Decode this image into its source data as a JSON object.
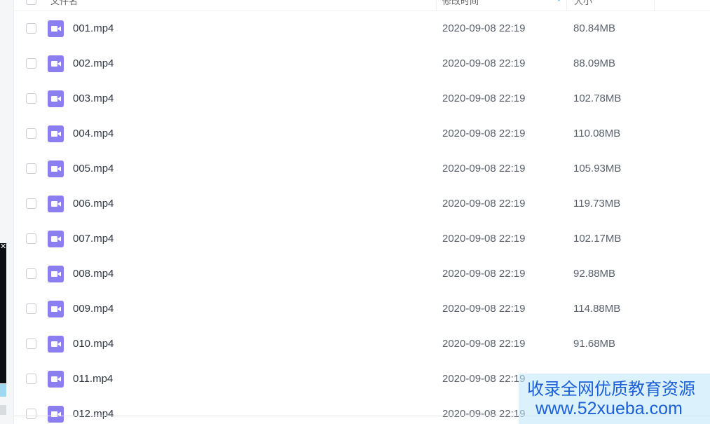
{
  "header": {
    "name_label": "文件名",
    "time_label": "修改时间",
    "size_label": "大小",
    "sort_icon": "sort-down-icon"
  },
  "files": [
    {
      "name": "001.mp4",
      "time": "2020-09-08 22:19",
      "size": "80.84MB"
    },
    {
      "name": "002.mp4",
      "time": "2020-09-08 22:19",
      "size": "88.09MB"
    },
    {
      "name": "003.mp4",
      "time": "2020-09-08 22:19",
      "size": "102.78MB"
    },
    {
      "name": "004.mp4",
      "time": "2020-09-08 22:19",
      "size": "110.08MB"
    },
    {
      "name": "005.mp4",
      "time": "2020-09-08 22:19",
      "size": "105.93MB"
    },
    {
      "name": "006.mp4",
      "time": "2020-09-08 22:19",
      "size": "119.73MB"
    },
    {
      "name": "007.mp4",
      "time": "2020-09-08 22:19",
      "size": "102.17MB"
    },
    {
      "name": "008.mp4",
      "time": "2020-09-08 22:19",
      "size": "92.88MB"
    },
    {
      "name": "009.mp4",
      "time": "2020-09-08 22:19",
      "size": "114.88MB"
    },
    {
      "name": "010.mp4",
      "time": "2020-09-08 22:19",
      "size": "91.68MB"
    },
    {
      "name": "011.mp4",
      "time": "2020-09-08 22:19",
      "size": ""
    },
    {
      "name": "012.mp4",
      "time": "2020-09-08 22:19",
      "size": ""
    }
  ],
  "file_icon": "video-file-icon",
  "colors": {
    "file_icon_bg": "#8a7ef0",
    "sort_accent": "#3b9bff",
    "watermark_text": "#1b5fd9"
  },
  "watermark": {
    "line1": "收录全网优质教育资源",
    "line2": "www.52xueba.com"
  }
}
